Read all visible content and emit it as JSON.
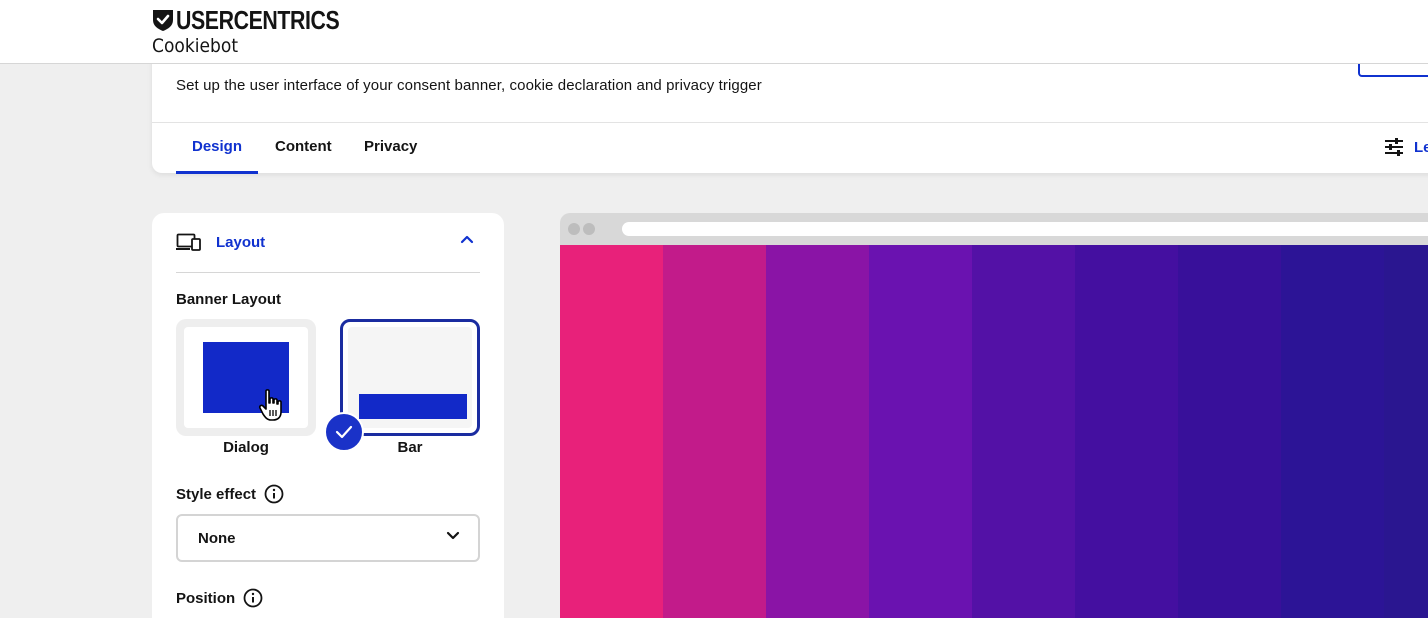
{
  "brand": {
    "name": "USERCENTRICS",
    "product": "Cookiebot"
  },
  "header": {
    "subtitle": "Set up the user interface of your consent banner, cookie declaration and privacy trigger",
    "tabs": [
      {
        "label": "Design",
        "active": true
      },
      {
        "label": "Content",
        "active": false
      },
      {
        "label": "Privacy",
        "active": false
      }
    ],
    "legacy_label": "Le"
  },
  "layout_section": {
    "title": "Layout",
    "banner_layout_label": "Banner Layout",
    "options": [
      {
        "label": "Dialog",
        "selected": false
      },
      {
        "label": "Bar",
        "selected": true
      }
    ],
    "style_effect_label": "Style effect",
    "style_effect_value": "None",
    "position_label": "Position"
  },
  "colors": {
    "accent": "#1032cf",
    "preview_stripes": [
      "#e8217a",
      "#c21b8a",
      "#8a14a6",
      "#6a12b0",
      "#5311a6",
      "#440fa0",
      "#38109a",
      "#2c1496",
      "#2a1690",
      "#3532c4",
      "#3f58e8",
      "#3a8ee8"
    ]
  }
}
